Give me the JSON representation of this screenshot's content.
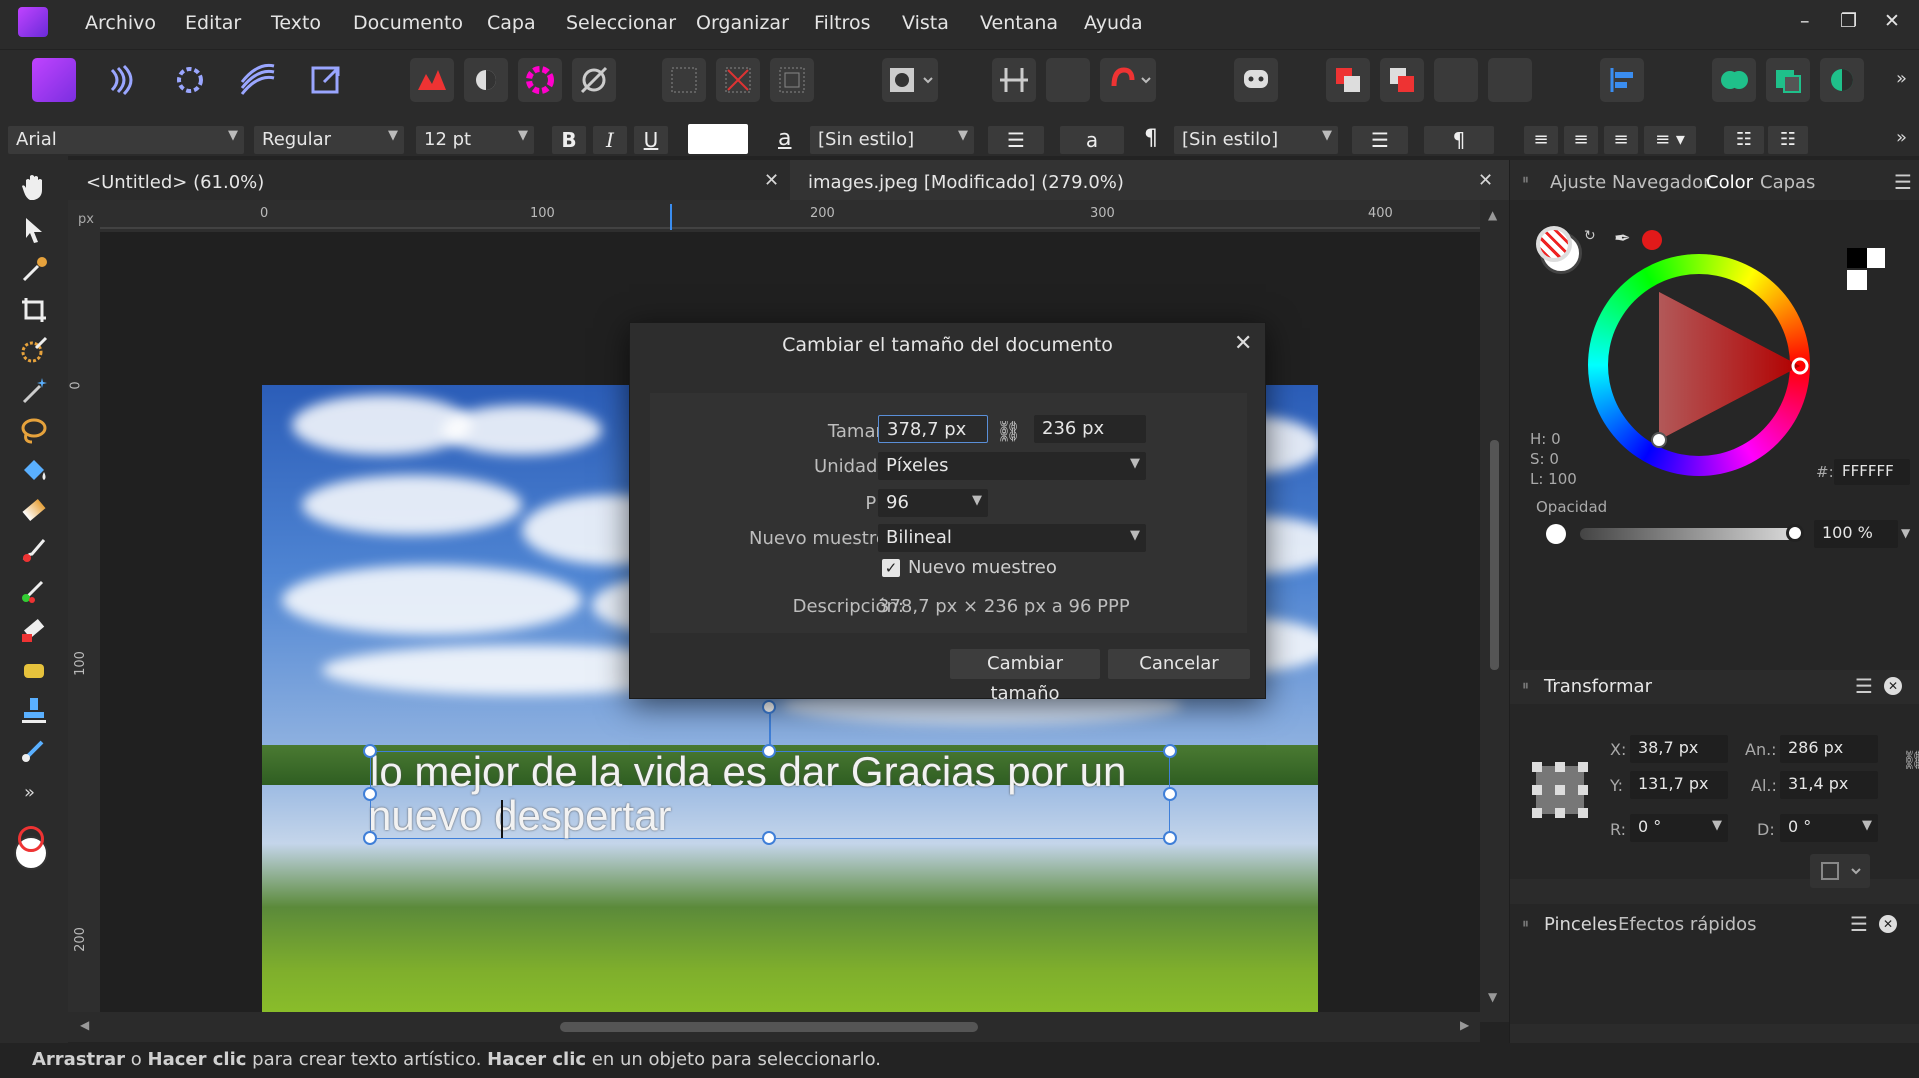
{
  "menu": [
    "Archivo",
    "Editar",
    "Texto",
    "Documento",
    "Capa",
    "Seleccionar",
    "Organizar",
    "Filtros",
    "Vista",
    "Ventana",
    "Ayuda"
  ],
  "context": {
    "font": "Arial",
    "style": "Regular",
    "size": "12 pt",
    "bold": "B",
    "italic": "I",
    "underline": "U",
    "char_a": "a",
    "para_style_1": "[Sin estilo]",
    "char_a2": "a",
    "pilcrow": "¶",
    "para_style_2": "[Sin estilo]",
    "pilcrow2": "¶"
  },
  "tabs": [
    {
      "label": "<Untitled> (61.0%)"
    },
    {
      "label": "images.jpeg [Modificado] (279.0%)"
    }
  ],
  "ruler": {
    "unit": "px",
    "top_ticks": [
      "0",
      "100",
      "200",
      "300",
      "400"
    ],
    "left_ticks": [
      "0",
      "100",
      "200"
    ]
  },
  "canvas_text": {
    "line1": "lo mejor de la vida es dar Gracias por un",
    "line2": "nuevo despertar"
  },
  "dialog": {
    "title": "Cambiar el tamaño del documento",
    "size_label": "Tamaño:",
    "width_value": "378,7 px",
    "height_value": "236 px",
    "units_label": "Unidades:",
    "units_value": "Píxeles",
    "ppp_label": "PPP:",
    "ppp_value": "96",
    "resample_label": "Nuevo muestreo:",
    "resample_value": "Bilineal",
    "resample_check": "Nuevo muestreo",
    "desc_label": "Descripción:",
    "desc_value": "378,7 px × 236 px a 96 PPP",
    "ok": "Cambiar tamaño",
    "cancel": "Cancelar"
  },
  "panel_tabs": [
    "Ajuste",
    "Navegador",
    "Color",
    "Capas"
  ],
  "color": {
    "h": "H: 0",
    "s": "S: 0",
    "l": "L: 100",
    "hex_label": "#:",
    "hex": "FFFFFF",
    "opacity_label": "Opacidad",
    "opacity": "100 %",
    "accent": "#e02020"
  },
  "transform": {
    "title": "Transformar",
    "x_label": "X:",
    "x": "38,7 px",
    "y_label": "Y:",
    "y": "131,7 px",
    "w_label": "An.:",
    "w": "286 px",
    "h_label": "Al.:",
    "h": "31,4 px",
    "r_label": "R:",
    "r": "0 °",
    "d_label": "D:",
    "d": "0 °"
  },
  "bottom_tabs": [
    "Pinceles",
    "Efectos rápidos"
  ],
  "status": {
    "b1": "Arrastrar",
    "t1": " o ",
    "b2": "Hacer clic",
    "t2": " para crear texto artístico. ",
    "b3": "Hacer clic",
    "t3": " en un objeto para seleccionarlo."
  }
}
